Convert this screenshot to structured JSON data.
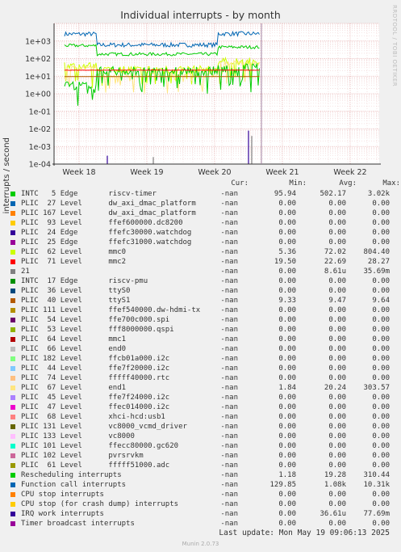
{
  "title": "Individual interrupts - by month",
  "side_label": "RRDTOOL / TOBI OETIKER",
  "footer": {
    "last_update": "Last update: Mon May 19 09:06:13 2025",
    "version": "Munin 2.0.73"
  },
  "columns": {
    "cur": "Cur:",
    "min": "Min:",
    "avg": "Avg:",
    "max": "Max:"
  },
  "chart_data": {
    "type": "line",
    "ylabel": "interrupts / second",
    "y_scale": "log",
    "ylim": [
      0.0001,
      10000
    ],
    "y_ticks": [
      "1e+03",
      "1e+02",
      "1e+01",
      "1e+00",
      "1e-01",
      "1e-02",
      "1e-03",
      "1e-04"
    ],
    "x_ticks": [
      "Week 18",
      "Week 19",
      "Week 20",
      "Week 21",
      "Week 22"
    ],
    "grid": true,
    "series": [
      {
        "name": "INTC   5 Edge       riscv-timer",
        "color": "#00cc00",
        "cur": "-nan",
        "min": "95.94",
        "avg": "502.17",
        "max": "3.02k"
      },
      {
        "name": "PLIC  27 Level      dw_axi_dmac_platform",
        "color": "#0066b3",
        "cur": "-nan",
        "min": "0.00",
        "avg": "0.00",
        "max": "0.00"
      },
      {
        "name": "PLIC 167 Level      dw_axi_dmac_platform",
        "color": "#ff8000",
        "cur": "-nan",
        "min": "0.00",
        "avg": "0.00",
        "max": "0.00"
      },
      {
        "name": "PLIC  93 Level      ffef600000.dc8200",
        "color": "#ffcc00",
        "cur": "-nan",
        "min": "0.00",
        "avg": "0.00",
        "max": "0.00"
      },
      {
        "name": "PLIC  24 Edge       ffefc30000.watchdog",
        "color": "#330099",
        "cur": "-nan",
        "min": "0.00",
        "avg": "0.00",
        "max": "0.00"
      },
      {
        "name": "PLIC  25 Edge       ffefc31000.watchdog",
        "color": "#990099",
        "cur": "-nan",
        "min": "0.00",
        "avg": "0.00",
        "max": "0.00"
      },
      {
        "name": "PLIC  62 Level      mmc0",
        "color": "#ccff00",
        "cur": "-nan",
        "min": "5.36",
        "avg": "72.02",
        "max": "804.40"
      },
      {
        "name": "PLIC  71 Level      mmc2",
        "color": "#ff0000",
        "cur": "-nan",
        "min": "19.50",
        "avg": "22.69",
        "max": "28.27"
      },
      {
        "name": "21",
        "color": "#808080",
        "cur": "-nan",
        "min": "0.00",
        "avg": "8.61u",
        "max": "35.69m"
      },
      {
        "name": "INTC  17 Edge       riscv-pmu",
        "color": "#008f00",
        "cur": "-nan",
        "min": "0.00",
        "avg": "0.00",
        "max": "0.00"
      },
      {
        "name": "PLIC  36 Level      ttyS0",
        "color": "#00487d",
        "cur": "-nan",
        "min": "0.00",
        "avg": "0.00",
        "max": "0.00"
      },
      {
        "name": "PLIC  40 Level      ttyS1",
        "color": "#b35a00",
        "cur": "-nan",
        "min": "9.33",
        "avg": "9.47",
        "max": "9.64"
      },
      {
        "name": "PLIC 111 Level      ffef540000.dw-hdmi-tx",
        "color": "#b38f00",
        "cur": "-nan",
        "min": "0.00",
        "avg": "0.00",
        "max": "0.00"
      },
      {
        "name": "PLIC  54 Level      ffe700c000.spi",
        "color": "#6b006b",
        "cur": "-nan",
        "min": "0.00",
        "avg": "0.00",
        "max": "0.00"
      },
      {
        "name": "PLIC  53 Level      fff8000000.qspi",
        "color": "#8fb300",
        "cur": "-nan",
        "min": "0.00",
        "avg": "0.00",
        "max": "0.00"
      },
      {
        "name": "PLIC  64 Level      mmc1",
        "color": "#b30000",
        "cur": "-nan",
        "min": "0.00",
        "avg": "0.00",
        "max": "0.00"
      },
      {
        "name": "PLIC  66 Level      end0",
        "color": "#bebebe",
        "cur": "-nan",
        "min": "0.00",
        "avg": "0.00",
        "max": "0.00"
      },
      {
        "name": "PLIC 182 Level      ffcb01a000.i2c",
        "color": "#80ff80",
        "cur": "-nan",
        "min": "0.00",
        "avg": "0.00",
        "max": "0.00"
      },
      {
        "name": "PLIC  44 Level      ffe7f20000.i2c",
        "color": "#80c9ff",
        "cur": "-nan",
        "min": "0.00",
        "avg": "0.00",
        "max": "0.00"
      },
      {
        "name": "PLIC  74 Level      fffff40000.rtc",
        "color": "#ffc080",
        "cur": "-nan",
        "min": "0.00",
        "avg": "0.00",
        "max": "0.00"
      },
      {
        "name": "PLIC  67 Level      end1",
        "color": "#ffe680",
        "cur": "-nan",
        "min": "1.84",
        "avg": "20.24",
        "max": "303.57"
      },
      {
        "name": "PLIC  45 Level      ffe7f24000.i2c",
        "color": "#aa80ff",
        "cur": "-nan",
        "min": "0.00",
        "avg": "0.00",
        "max": "0.00"
      },
      {
        "name": "PLIC  47 Level      ffec014000.i2c",
        "color": "#ee00cc",
        "cur": "-nan",
        "min": "0.00",
        "avg": "0.00",
        "max": "0.00"
      },
      {
        "name": "PLIC  68 Level      xhci-hcd:usb1",
        "color": "#ff8080",
        "cur": "-nan",
        "min": "0.00",
        "avg": "0.00",
        "max": "0.00"
      },
      {
        "name": "PLIC 131 Level      vc8000_vcmd_driver",
        "color": "#666600",
        "cur": "-nan",
        "min": "0.00",
        "avg": "0.00",
        "max": "0.00"
      },
      {
        "name": "PLIC 133 Level      vc8000",
        "color": "#ffbfff",
        "cur": "-nan",
        "min": "0.00",
        "avg": "0.00",
        "max": "0.00"
      },
      {
        "name": "PLIC 101 Level      ffecc80000.gc620",
        "color": "#00ffcc",
        "cur": "-nan",
        "min": "0.00",
        "avg": "0.00",
        "max": "0.00"
      },
      {
        "name": "PLIC 102 Level      pvrsrvkm",
        "color": "#cc6699",
        "cur": "-nan",
        "min": "0.00",
        "avg": "0.00",
        "max": "0.00"
      },
      {
        "name": "PLIC  61 Level      fffff51000.adc",
        "color": "#999900",
        "cur": "-nan",
        "min": "0.00",
        "avg": "0.00",
        "max": "0.00"
      },
      {
        "name": "Rescheduling interrupts",
        "color": "#00cc00",
        "cur": "-nan",
        "min": "1.18",
        "avg": "19.28",
        "max": "310.44"
      },
      {
        "name": "Function call interrupts",
        "color": "#0066b3",
        "cur": "-nan",
        "min": "129.85",
        "avg": "1.08k",
        "max": "10.31k"
      },
      {
        "name": "CPU stop interrupts",
        "color": "#ff8000",
        "cur": "-nan",
        "min": "0.00",
        "avg": "0.00",
        "max": "0.00"
      },
      {
        "name": "CPU stop (for crash dump) interrupts",
        "color": "#ffcc00",
        "cur": "-nan",
        "min": "0.00",
        "avg": "0.00",
        "max": "0.00"
      },
      {
        "name": "IRQ work interrupts",
        "color": "#330099",
        "cur": "-nan",
        "min": "0.00",
        "avg": "36.61u",
        "max": "77.69m"
      },
      {
        "name": "Timer broadcast interrupts",
        "color": "#990099",
        "cur": "-nan",
        "min": "0.00",
        "avg": "0.00",
        "max": "0.00"
      }
    ]
  }
}
